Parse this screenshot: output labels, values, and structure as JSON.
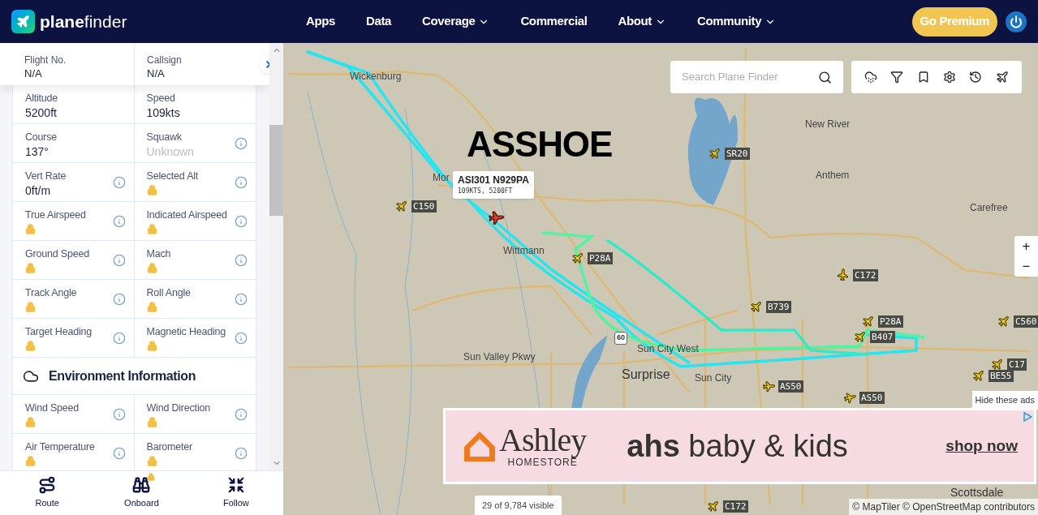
{
  "header": {
    "logo": "**plane**finder",
    "nav": [
      {
        "label": "Apps",
        "dropdown": false
      },
      {
        "label": "Data",
        "dropdown": false
      },
      {
        "label": "Coverage",
        "dropdown": true
      },
      {
        "label": "Commercial",
        "dropdown": false
      },
      {
        "label": "About",
        "dropdown": true
      },
      {
        "label": "Community",
        "dropdown": true
      }
    ],
    "premium_button": "Go Premium"
  },
  "flight_panel": {
    "top_fields": [
      {
        "label": "Flight No.",
        "value": "N/A"
      },
      {
        "label": "Callsign",
        "value": "N/A"
      }
    ],
    "rows": [
      {
        "kind": "pair",
        "cells": [
          {
            "label": "Altitude",
            "kind": "value",
            "value": "5200ft",
            "info": false
          },
          {
            "label": "Speed",
            "kind": "value",
            "value": "109kts",
            "info": false
          }
        ]
      },
      {
        "kind": "pair",
        "cells": [
          {
            "label": "Course",
            "kind": "value",
            "value": "137°",
            "info": false
          },
          {
            "label": "Squawk",
            "kind": "muted",
            "value": "Unknown",
            "info": true
          }
        ]
      },
      {
        "kind": "pair",
        "cells": [
          {
            "label": "Vert Rate",
            "kind": "value",
            "value": "0ft/m",
            "info": true
          },
          {
            "label": "Selected Alt",
            "kind": "locked",
            "info": true
          }
        ]
      },
      {
        "kind": "pair",
        "cells": [
          {
            "label": "True Airspeed",
            "kind": "locked",
            "info": true
          },
          {
            "label": "Indicated Airspeed",
            "kind": "locked",
            "info": true
          }
        ]
      },
      {
        "kind": "pair",
        "cells": [
          {
            "label": "Ground Speed",
            "kind": "locked",
            "info": true
          },
          {
            "label": "Mach",
            "kind": "locked",
            "info": true
          }
        ]
      },
      {
        "kind": "pair",
        "cells": [
          {
            "label": "Track Angle",
            "kind": "locked",
            "info": true
          },
          {
            "label": "Roll Angle",
            "kind": "locked",
            "info": true
          }
        ]
      },
      {
        "kind": "pair",
        "cells": [
          {
            "label": "Target Heading",
            "kind": "locked",
            "info": true
          },
          {
            "label": "Magnetic Heading",
            "kind": "locked",
            "info": true
          }
        ]
      },
      {
        "kind": "section",
        "title": "Environment Information"
      },
      {
        "kind": "pair",
        "cells": [
          {
            "label": "Wind Speed",
            "kind": "locked",
            "info": true
          },
          {
            "label": "Wind Direction",
            "kind": "locked",
            "info": true
          }
        ]
      },
      {
        "kind": "pair",
        "cells": [
          {
            "label": "Air Temperature",
            "kind": "locked",
            "info": true
          },
          {
            "label": "Barometer",
            "kind": "locked",
            "info": true
          }
        ]
      }
    ],
    "actions": [
      {
        "label": "Route",
        "locked": false
      },
      {
        "label": "Onboard",
        "locked": true
      },
      {
        "label": "Follow",
        "locked": false
      }
    ]
  },
  "map": {
    "search": {
      "placeholder": "Search Plane Finder"
    },
    "overlay_text": "ASSHOE",
    "popup": {
      "title": "ASI301 N929PA",
      "subtitle": "109KTS, 5200FT"
    },
    "places": [
      "Wickenburg",
      "Mor",
      "Wittmann",
      "New River",
      "Anthem",
      "Carefree",
      "Sun Valley Pkwy",
      "Sun City West",
      "Surprise",
      "Sun City",
      "Scottsdale"
    ],
    "highway_shield": "60",
    "aircraft": [
      {
        "label": "C150"
      },
      {
        "label": "SR20"
      },
      {
        "label": "P28A"
      },
      {
        "label": "C172"
      },
      {
        "label": "B739"
      },
      {
        "label": "P28A"
      },
      {
        "label": "B407"
      },
      {
        "label": "C560"
      },
      {
        "label": "C17"
      },
      {
        "label": "BE55"
      },
      {
        "label": "AS50"
      },
      {
        "label": "AS50"
      },
      {
        "label": "C172"
      }
    ],
    "zoom": [
      "+",
      "−"
    ],
    "visible_count": "29 of 9,784 visible",
    "attribution": "© MapTiler © OpenStreetMap contributors",
    "ad": {
      "hide": "Hide these ads",
      "brand": "Ashley",
      "brand_sub": "HOMESTORE",
      "headline": "**ahs** baby & kids",
      "cta": "shop now"
    }
  }
}
